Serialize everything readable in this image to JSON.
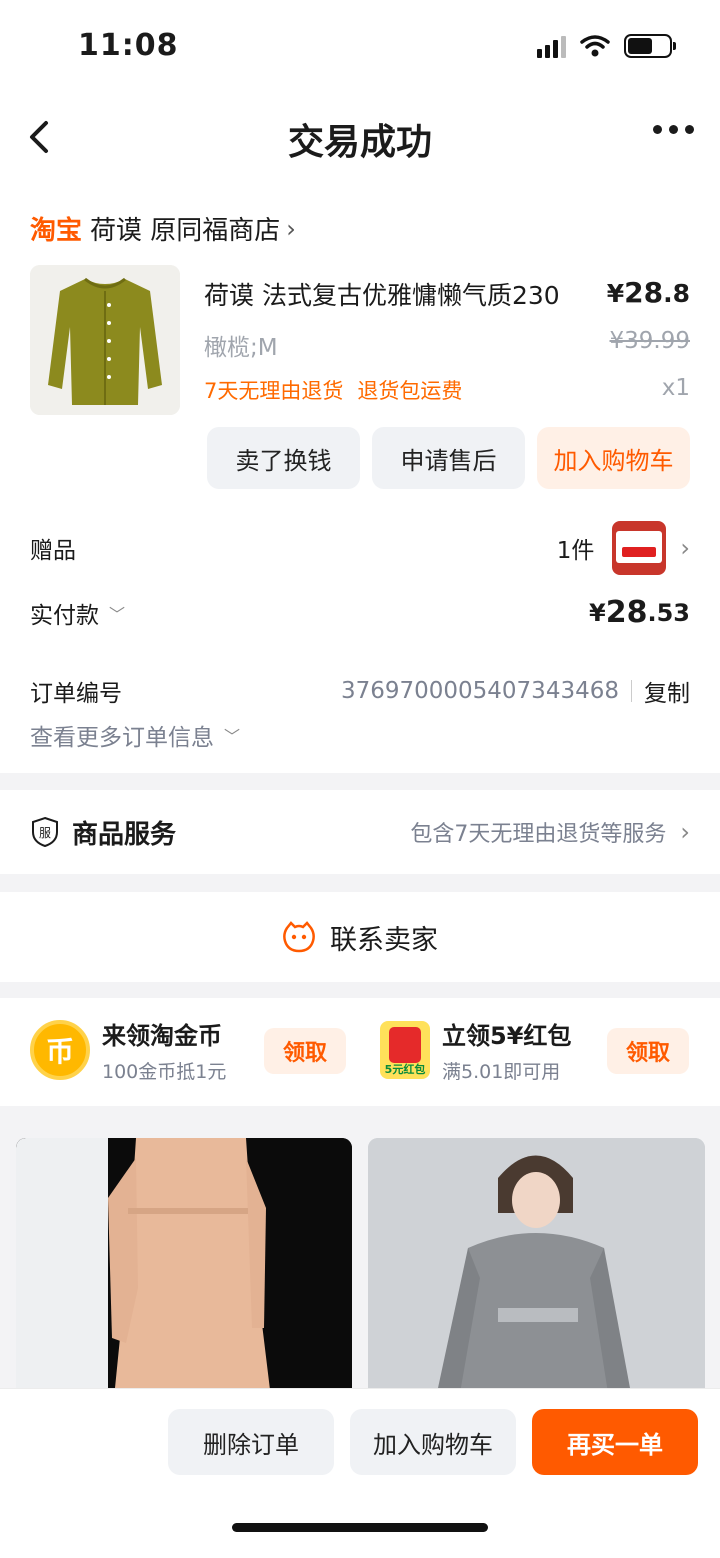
{
  "status_bar": {
    "time": "11:08"
  },
  "header": {
    "title": "交易成功"
  },
  "shop": {
    "platform": "淘宝",
    "name": "荷谟 原同福商店"
  },
  "product": {
    "name": "荷谟 法式复古优雅慵懒气质230",
    "price_symbol": "¥",
    "price_int": "28",
    "price_dec": ".8",
    "sku": "橄榄;M",
    "original_price": "¥39.99",
    "tag_return": "7天无理由退货",
    "tag_shipping": "退货包运费",
    "quantity": "x1"
  },
  "card_actions": {
    "sell": "卖了换钱",
    "after_sale": "申请售后",
    "add_cart": "加入购物车"
  },
  "gift": {
    "label": "赠品",
    "count": "1件"
  },
  "payment": {
    "label": "实付款",
    "symbol": "¥",
    "int": "28",
    "dec": ".53"
  },
  "order": {
    "label": "订单编号",
    "number": "3769700005407343468",
    "copy": "复制",
    "more": "查看更多订单信息"
  },
  "service": {
    "icon_text": "服",
    "title": "商品服务",
    "desc": "包含7天无理由退货等服务"
  },
  "contact": {
    "label": "联系卖家"
  },
  "promos": [
    {
      "icon_text": "币",
      "title": "来领淘金币",
      "sub": "100金币抵1元",
      "action": "领取"
    },
    {
      "icon_text": "5元红包",
      "title": "立领5¥红包",
      "sub": "满5.01即可用",
      "action": "领取"
    }
  ],
  "bottom_bar": {
    "delete": "删除订单",
    "add_cart": "加入购物车",
    "rebuy": "再买一单"
  },
  "colors": {
    "accent": "#ff5a00",
    "accent_light": "#fff0e6",
    "gray_text": "#7b8190"
  }
}
